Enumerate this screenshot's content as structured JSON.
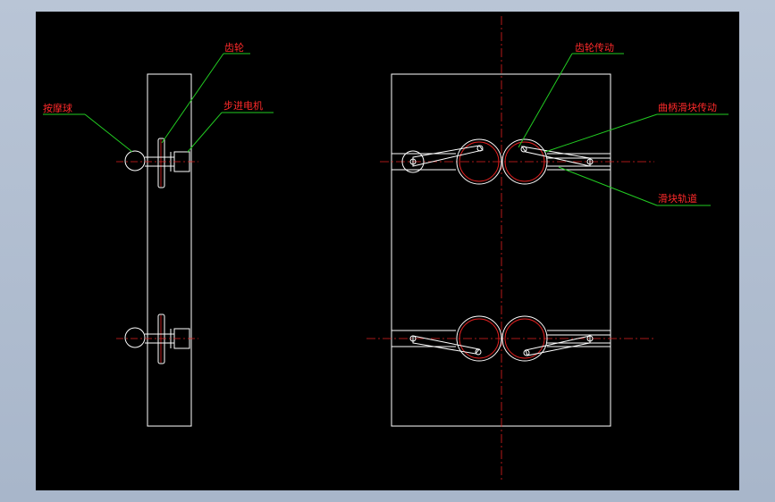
{
  "labels": {
    "gear": "齿轮",
    "stepper_motor": "步进电机",
    "massage_ball": "按摩球",
    "gear_transmission": "齿轮传动",
    "crank_slider": "曲柄滑块传动",
    "slider_track": "滑块轨道"
  },
  "colors": {
    "background": "#000000",
    "outline": "#ffffff",
    "label": "#ff2a2a",
    "leader": "#22cc22",
    "centerline": "#e02020"
  }
}
